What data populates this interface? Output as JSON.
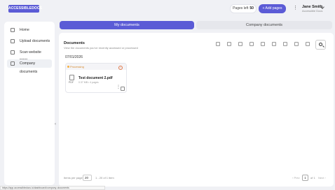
{
  "header": {
    "logo_text": "ACCESSIBLEDOCS",
    "pages_left_label": "Pages left",
    "pages_left_value": "50",
    "add_pages_label": "+ Add pages",
    "user_name": "Jane Smith",
    "user_role": "Accessible Docs"
  },
  "sidebar": {
    "items": [
      {
        "label": "Home",
        "icon": "home-icon"
      },
      {
        "label": "Upload documents",
        "icon": "upload-icon"
      },
      {
        "label": "Scan website PDF's",
        "icon": "scan-icon"
      },
      {
        "label": "Company documents",
        "icon": "folder-icon"
      }
    ],
    "collapse_glyph": "‹"
  },
  "tabs": [
    {
      "label": "My documents",
      "active": true
    },
    {
      "label": "Company documents",
      "active": false
    }
  ],
  "panel": {
    "title": "Documents",
    "subtitle": "View the documents you've recently accessed or processed",
    "toolbar_icons": [
      "filter-icon",
      "download-icon",
      "tag-icon",
      "archive-icon",
      "copy-icon",
      "trash-icon",
      "sort-icon",
      "columns-icon",
      "grid-view-icon",
      "list-view-icon"
    ],
    "search_icon": "search-icon"
  },
  "date_group": "07/01/2026",
  "document": {
    "status": "Processing",
    "name": "Test document 2.pdf",
    "meta": "0.37 MB • 4 pages",
    "file_type": "PDF",
    "menu_glyph": "⋮"
  },
  "footer": {
    "items_per_page_label": "Items per page",
    "items_per_page_value": "20",
    "range_text": "1 - 20 of 1 item",
    "prev_label": "‹ Prev",
    "page_number": "1",
    "page_of": "of 1",
    "next_label": "Next ›"
  },
  "status_bar": "https://app.accessibledocs.io/dashboard/company-documents",
  "colors": {
    "accent": "#5b5bd6",
    "processing": "#f5b041",
    "warning": "#e07a4a"
  }
}
